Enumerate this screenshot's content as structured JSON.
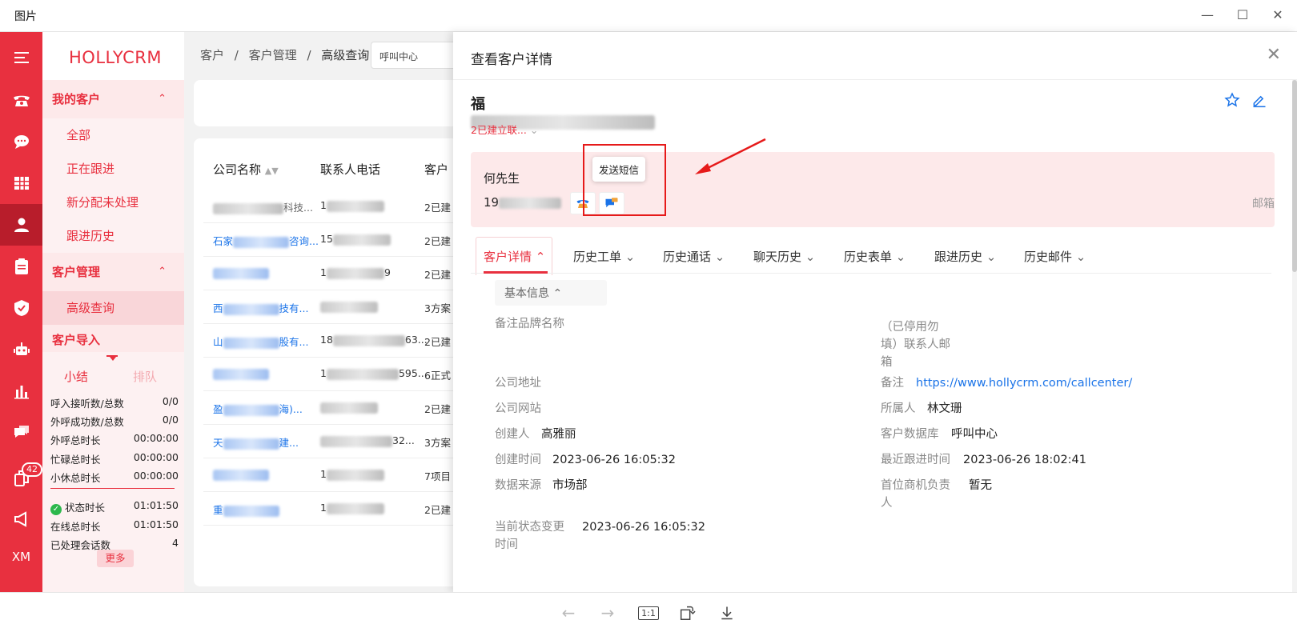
{
  "window": {
    "title": "图片"
  },
  "rail": {
    "items": [
      "menu-icon",
      "phone-icon",
      "chat-icon",
      "grid-icon",
      "user-icon",
      "clipboard-icon",
      "shield-icon",
      "robot-icon",
      "chart-icon",
      "message-icon",
      "copy-icon",
      "megaphone-icon",
      "xm-icon"
    ],
    "badge": "42",
    "xm": "XM"
  },
  "menu": {
    "logo": "HOLLYCRM",
    "my_customers": "我的客户",
    "items1": [
      "全部",
      "正在跟进",
      "新分配未处理",
      "跟进历史"
    ],
    "customer_mgmt": "客户管理",
    "items2": [
      "高级查询"
    ],
    "customer_import": "客户导入"
  },
  "stats": {
    "tab_summary": "小结",
    "tab_queue": "排队",
    "rows": [
      {
        "label": "呼入接听数/总数",
        "value": "0/0"
      },
      {
        "label": "外呼成功数/总数",
        "value": "0/0"
      },
      {
        "label": "外呼总时长",
        "value": "00:00:00"
      },
      {
        "label": "忙碌总时长",
        "value": "00:00:00"
      },
      {
        "label": "小休总时长",
        "value": "00:00:00"
      },
      {
        "label": "状态时长",
        "value": "01:01:50"
      },
      {
        "label": "在线总时长",
        "value": "01:01:50"
      },
      {
        "label": "已处理会话数",
        "value": "4"
      }
    ],
    "more": "更多"
  },
  "breadcrumb": {
    "items": [
      "客户",
      "客户管理",
      "高级查询"
    ],
    "sep": "/",
    "select": "呼叫中心"
  },
  "table": {
    "headers": [
      "公司名称",
      "联系人电话",
      "客户"
    ],
    "rows": [
      {
        "company": "科技...",
        "phone": "1",
        "status": "2已建"
      },
      {
        "company": "石家",
        "company2": "咨询...",
        "phone": "15",
        "status": "2已建"
      },
      {
        "company": "",
        "company2": "",
        "phone": "1",
        "phone2": "9",
        "status": "2已建"
      },
      {
        "company": "西",
        "company2": "技有...",
        "phone": "",
        "status": "3方案"
      },
      {
        "company": "山",
        "company2": "股有...",
        "phone": "18",
        "phone2": "63...",
        "status": "2已建"
      },
      {
        "company": "",
        "company2": "",
        "phone": "1",
        "phone2": "595...",
        "status": "6正式"
      },
      {
        "company": "盈",
        "company2": "海)...",
        "phone": "",
        "status": "2已建"
      },
      {
        "company": "天",
        "company2": "建...",
        "phone": "",
        "phone2": "32...",
        "status": "3方案"
      },
      {
        "company": "",
        "company2": "",
        "phone": "1",
        "status": "7项目"
      },
      {
        "company": "重",
        "company2": "",
        "phone": "1",
        "status": "2已建"
      }
    ]
  },
  "drawer": {
    "title": "查看客户详情",
    "name_prefix": "福",
    "status": "2已建立联...",
    "contact_name": "何先生",
    "contact_phone_prefix": "19",
    "email_label": "邮箱",
    "tooltip": "发送短信",
    "tabs": [
      "客户详情",
      "历史工单",
      "历史通话",
      "聊天历史",
      "历史表单",
      "跟进历史",
      "历史邮件"
    ],
    "section_title": "基本信息",
    "fields_left": [
      {
        "label": "备注品牌名称",
        "value": ""
      },
      {
        "label": "公司地址",
        "value": ""
      },
      {
        "label": "公司网站",
        "value": ""
      },
      {
        "label": "创建人",
        "value": "高雅丽"
      },
      {
        "label": "创建时间",
        "value": "2023-06-26 16:05:32"
      },
      {
        "label": "数据来源",
        "value": "市场部"
      },
      {
        "label": "当前状态变更",
        "label2": "时间",
        "value": "2023-06-26 16:05:32"
      }
    ],
    "fields_right": [
      {
        "label": "（已停用勿",
        "label2": "填）联系人邮",
        "label3": "箱",
        "value": ""
      },
      {
        "label": "备注",
        "value": "https://www.hollycrm.com/callcenter/"
      },
      {
        "label": "所属人",
        "value": "林文珊"
      },
      {
        "label": "客户数据库",
        "value": "呼叫中心"
      },
      {
        "label": "最近跟进时间",
        "value": "2023-06-26 18:02:41"
      },
      {
        "label": "首位商机负责",
        "label2": "人",
        "value": "暂无"
      }
    ]
  },
  "viewer": {
    "actual_size": "1:1"
  },
  "colors": {
    "brand": "#e8303f",
    "link": "#1a73e8",
    "highlight": "#e61a1a"
  }
}
